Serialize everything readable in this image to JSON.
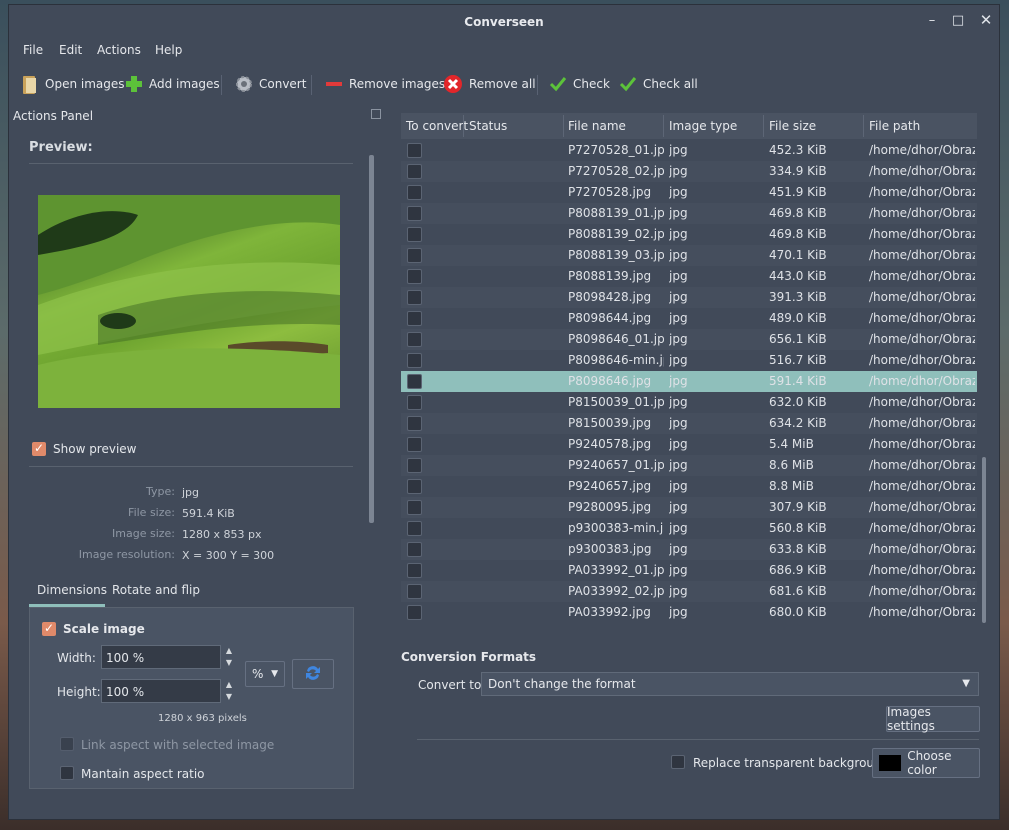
{
  "window": {
    "title": "Converseen"
  },
  "menu": {
    "file": "File",
    "edit": "Edit",
    "actions": "Actions",
    "help": "Help"
  },
  "toolbar": {
    "open_images": "Open images",
    "add_images": "Add images",
    "convert": "Convert",
    "remove_images": "Remove images",
    "remove_all": "Remove all",
    "check": "Check",
    "check_all": "Check all"
  },
  "actions_panel": {
    "title": "Actions Panel",
    "preview_label": "Preview:",
    "show_preview": "Show preview",
    "info": {
      "type_label": "Type:",
      "type_value": "jpg",
      "file_size_label": "File size:",
      "file_size_value": "591.4 KiB",
      "image_size_label": "Image size:",
      "image_size_value": "1280 x 853 px",
      "resolution_label": "Image resolution:",
      "resolution_value": "X = 300 Y = 300"
    },
    "tabs": {
      "dimensions": "Dimensions",
      "rotate": "Rotate and flip"
    },
    "dimensions": {
      "scale_image": "Scale image",
      "width_label": "Width:",
      "width_value": "100 %",
      "height_label": "Height:",
      "height_value": "100 %",
      "unit": "%",
      "pixels_text": "1280 x 963 pixels",
      "link_aspect": "Link aspect with selected image",
      "maintain_aspect": "Mantain aspect ratio"
    }
  },
  "table": {
    "headers": [
      "To convert",
      "Status",
      "File name",
      "Image type",
      "File size",
      "File path"
    ],
    "rows": [
      {
        "name": "P7270528_01.jpg",
        "type": "jpg",
        "size": "452.3 KiB",
        "path": "/home/dhor/Obraz..."
      },
      {
        "name": "P7270528_02.jpg",
        "type": "jpg",
        "size": "334.9 KiB",
        "path": "/home/dhor/Obraz..."
      },
      {
        "name": "P7270528.jpg",
        "type": "jpg",
        "size": "451.9 KiB",
        "path": "/home/dhor/Obraz..."
      },
      {
        "name": "P8088139_01.jpg",
        "type": "jpg",
        "size": "469.8 KiB",
        "path": "/home/dhor/Obraz..."
      },
      {
        "name": "P8088139_02.jpg",
        "type": "jpg",
        "size": "469.8 KiB",
        "path": "/home/dhor/Obraz..."
      },
      {
        "name": "P8088139_03.jpg",
        "type": "jpg",
        "size": "470.1 KiB",
        "path": "/home/dhor/Obraz..."
      },
      {
        "name": "P8088139.jpg",
        "type": "jpg",
        "size": "443.0 KiB",
        "path": "/home/dhor/Obraz..."
      },
      {
        "name": "P8098428.jpg",
        "type": "jpg",
        "size": "391.3 KiB",
        "path": "/home/dhor/Obraz..."
      },
      {
        "name": "P8098644.jpg",
        "type": "jpg",
        "size": "489.0 KiB",
        "path": "/home/dhor/Obraz..."
      },
      {
        "name": "P8098646_01.jpg",
        "type": "jpg",
        "size": "656.1 KiB",
        "path": "/home/dhor/Obraz..."
      },
      {
        "name": "P8098646-min.jpg",
        "type": "jpg",
        "size": "516.7 KiB",
        "path": "/home/dhor/Obraz..."
      },
      {
        "name": "P8098646.jpg",
        "type": "jpg",
        "size": "591.4 KiB",
        "path": "/home/dhor/Obraz...",
        "selected": true
      },
      {
        "name": "P8150039_01.jpg",
        "type": "jpg",
        "size": "632.0 KiB",
        "path": "/home/dhor/Obraz..."
      },
      {
        "name": "P8150039.jpg",
        "type": "jpg",
        "size": "634.2 KiB",
        "path": "/home/dhor/Obraz..."
      },
      {
        "name": "P9240578.jpg",
        "type": "jpg",
        "size": "5.4 MiB",
        "path": "/home/dhor/Obraz..."
      },
      {
        "name": "P9240657_01.jpg",
        "type": "jpg",
        "size": "8.6 MiB",
        "path": "/home/dhor/Obraz..."
      },
      {
        "name": "P9240657.jpg",
        "type": "jpg",
        "size": "8.8 MiB",
        "path": "/home/dhor/Obraz..."
      },
      {
        "name": "P9280095.jpg",
        "type": "jpg",
        "size": "307.9 KiB",
        "path": "/home/dhor/Obraz..."
      },
      {
        "name": "p9300383-min.jpg",
        "type": "jpg",
        "size": "560.8 KiB",
        "path": "/home/dhor/Obraz..."
      },
      {
        "name": "p9300383.jpg",
        "type": "jpg",
        "size": "633.8 KiB",
        "path": "/home/dhor/Obraz..."
      },
      {
        "name": "PA033992_01.jpg",
        "type": "jpg",
        "size": "686.9 KiB",
        "path": "/home/dhor/Obraz..."
      },
      {
        "name": "PA033992_02.jpg",
        "type": "jpg",
        "size": "681.6 KiB",
        "path": "/home/dhor/Obraz..."
      },
      {
        "name": "PA033992.jpg",
        "type": "jpg",
        "size": "680.0 KiB",
        "path": "/home/dhor/Obraz..."
      }
    ]
  },
  "conversion": {
    "title": "Conversion Formats",
    "convert_to_label": "Convert to:",
    "convert_to_value": "Don't change the format",
    "images_settings": "Images settings",
    "replace_transparent": "Replace transparent background",
    "choose_color": "Choose color",
    "color_swatch": "#000000"
  },
  "colors": {
    "accent": "#e08a6a",
    "selection": "#8fbfbb"
  }
}
